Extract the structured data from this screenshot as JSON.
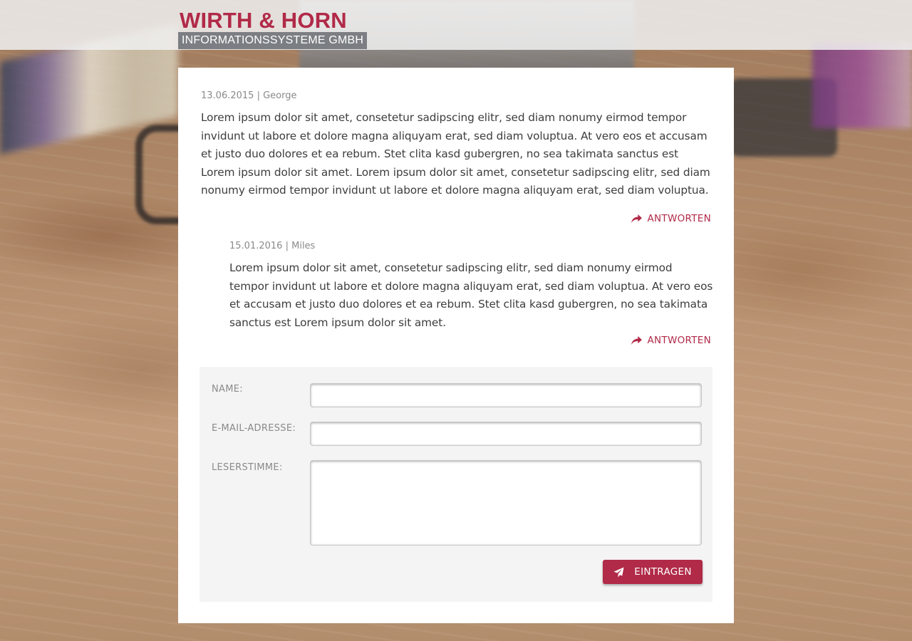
{
  "brand": {
    "name_primary": "WIRTH & HORN",
    "name_secondary": "INFORMATIONSSYSTEME GMBH",
    "accent_color": "#b12a48"
  },
  "comments": [
    {
      "date": "13.06.2015",
      "author": "George",
      "separator": "|",
      "text": "Lorem ipsum dolor sit amet, consetetur sadipscing elitr, sed diam nonumy eirmod tempor invidunt ut labore et dolore magna aliquyam erat, sed diam voluptua. At vero eos et accusam et justo duo dolores et ea rebum. Stet clita kasd gubergren, no sea takimata sanctus est Lorem ipsum dolor sit amet. Lorem ipsum dolor sit amet, consetetur sadipscing elitr, sed diam nonumy eirmod tempor invidunt ut labore et dolore magna aliquyam erat, sed diam voluptua.",
      "reply_label": "ANTWORTEN",
      "reply_icon": "share-icon"
    },
    {
      "date": "15.01.2016",
      "author": "Miles",
      "separator": "|",
      "text": "Lorem ipsum dolor sit amet, consetetur sadipscing elitr, sed diam nonumy eirmod tempor invidunt ut labore et dolore magna aliquyam erat, sed diam voluptua. At vero eos et accusam et justo duo dolores et ea rebum. Stet clita kasd gubergren, no sea takimata sanctus est Lorem ipsum dolor sit amet.",
      "reply_label": "ANTWORTEN",
      "reply_icon": "share-icon"
    }
  ],
  "form": {
    "name_label": "NAME:",
    "name_value": "",
    "email_label": "E-MAIL-ADRESSE:",
    "email_value": "",
    "message_label": "LESERSTIMME:",
    "message_value": "",
    "submit_label": "EINTRAGEN",
    "submit_icon": "paper-plane-icon"
  }
}
